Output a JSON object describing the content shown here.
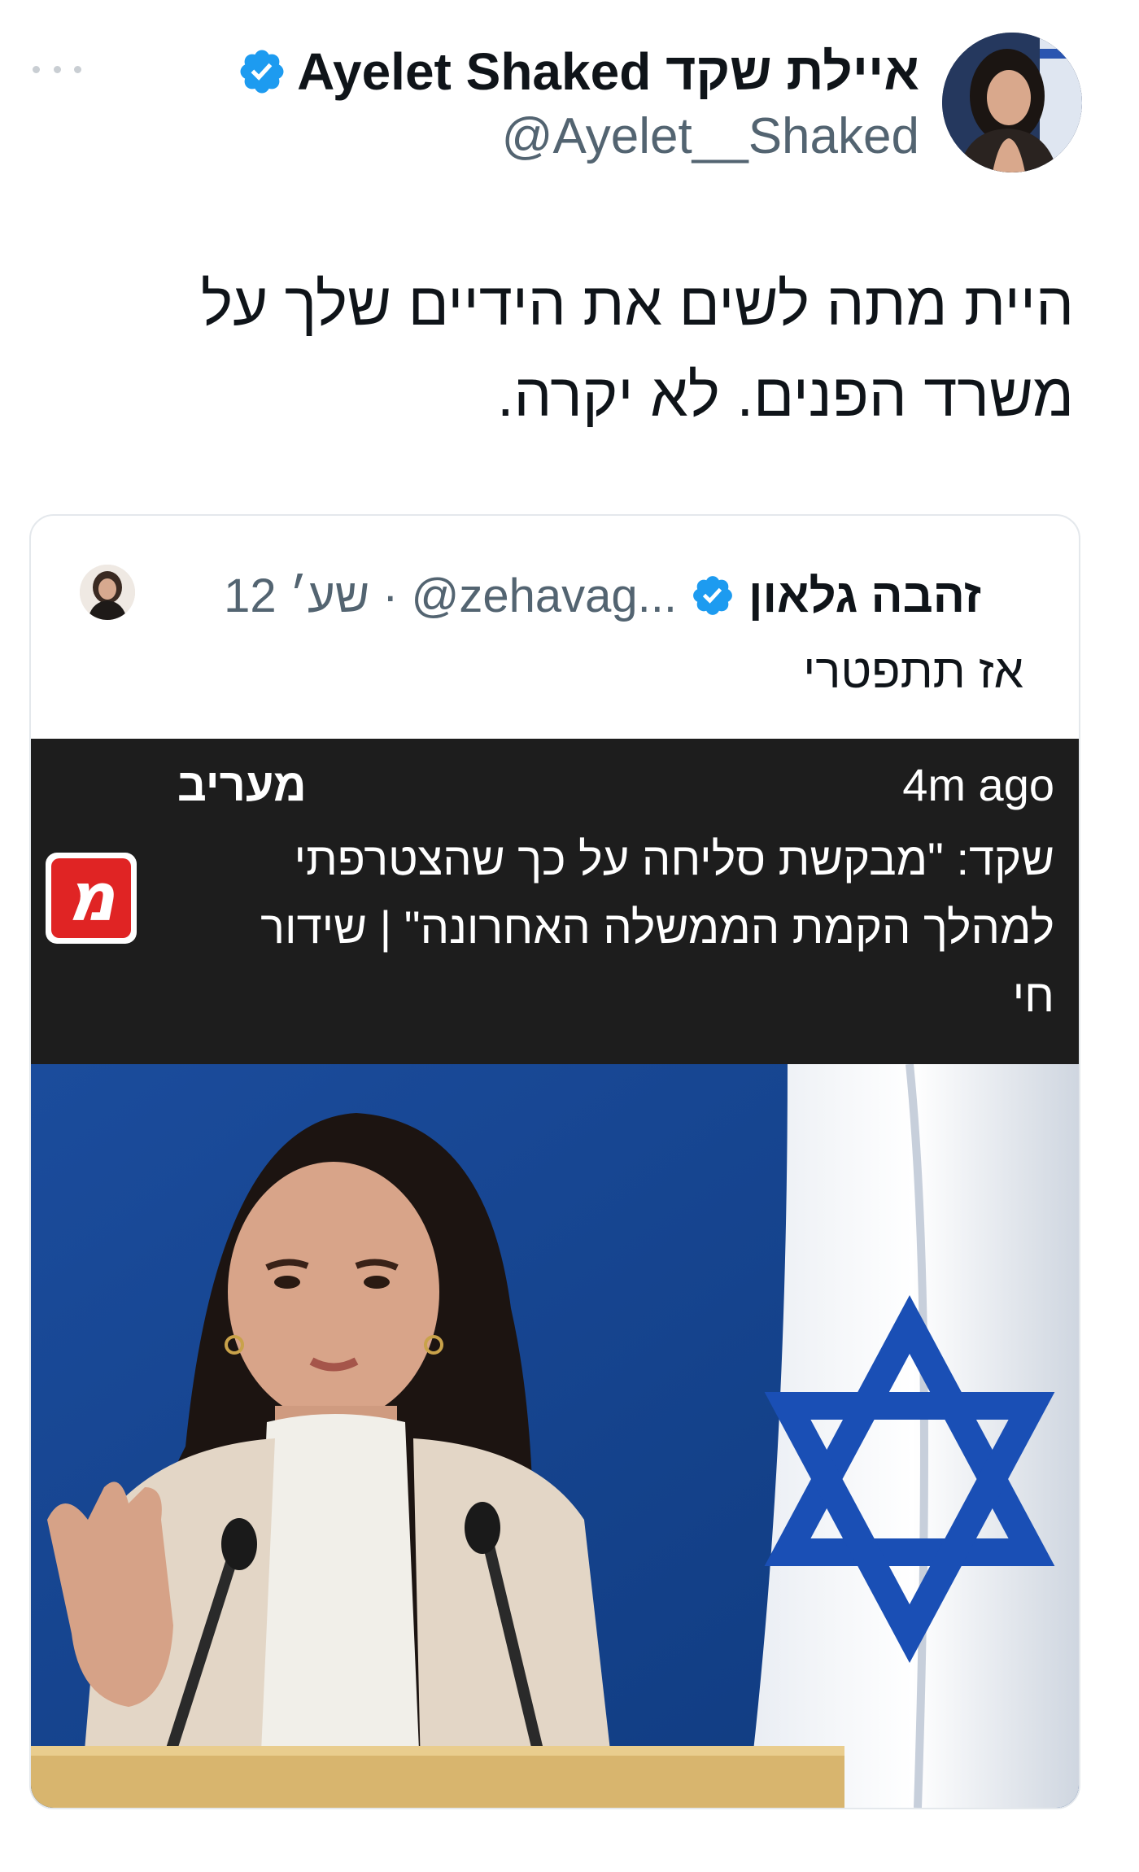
{
  "author": {
    "display_name": "Ayelet Shaked איילת שקד",
    "handle": "@Ayelet__Shaked",
    "verified": true
  },
  "tweet": {
    "text": "היית מתה לשים את הידיים שלך על משרד הפנים. לא יקרה."
  },
  "quoted_tweet": {
    "time": "12 שע׳",
    "separator": "·",
    "handle": "@zehavag...",
    "display_name": "זהבה גלאון",
    "verified": true,
    "text": "אז תתפטרי",
    "media": {
      "banner_time": "4m ago",
      "banner_source": "מעריב",
      "headline": "שקד: \"מבקשת סליחה על כך שהצטרפתי למהלך הקמת הממשלה האחרונה\" | שידור חי",
      "logo_glyph": "מ"
    }
  },
  "colors": {
    "verified_blue": "#1d9bf0",
    "secondary_text": "#536471",
    "banner_bg": "#1d1d1d",
    "maariv_red": "#e02424",
    "flag_blue": "#1a4fb5"
  },
  "icons": {
    "more": "more-icon",
    "verified": "verified-badge-icon"
  }
}
